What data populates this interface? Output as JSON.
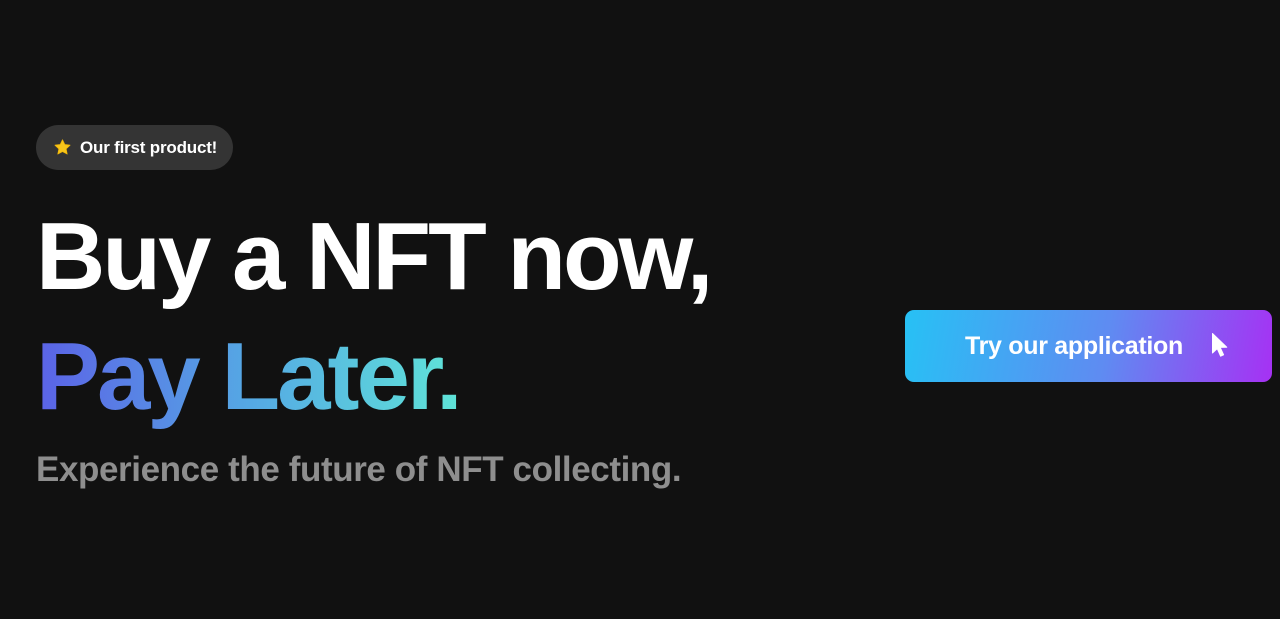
{
  "badge": {
    "icon": "star-icon",
    "icon_color": "#f7c51b",
    "label": "Our first product!"
  },
  "hero": {
    "headline": "Buy a NFT now,",
    "headline_accent": "Pay Later.",
    "subtitle": "Experience the future of NFT collecting.",
    "accent_gradient": [
      "#5b62e6",
      "#55a8e4",
      "#5fe4d8"
    ]
  },
  "cta": {
    "label": "Try our application",
    "icon": "pointer-cursor-icon",
    "gradient": [
      "#27c1f4",
      "#5f8bf2",
      "#a631f3"
    ]
  },
  "colors": {
    "background": "#111111",
    "badge_background": "#343434",
    "subtitle": "#8e8e8e"
  }
}
